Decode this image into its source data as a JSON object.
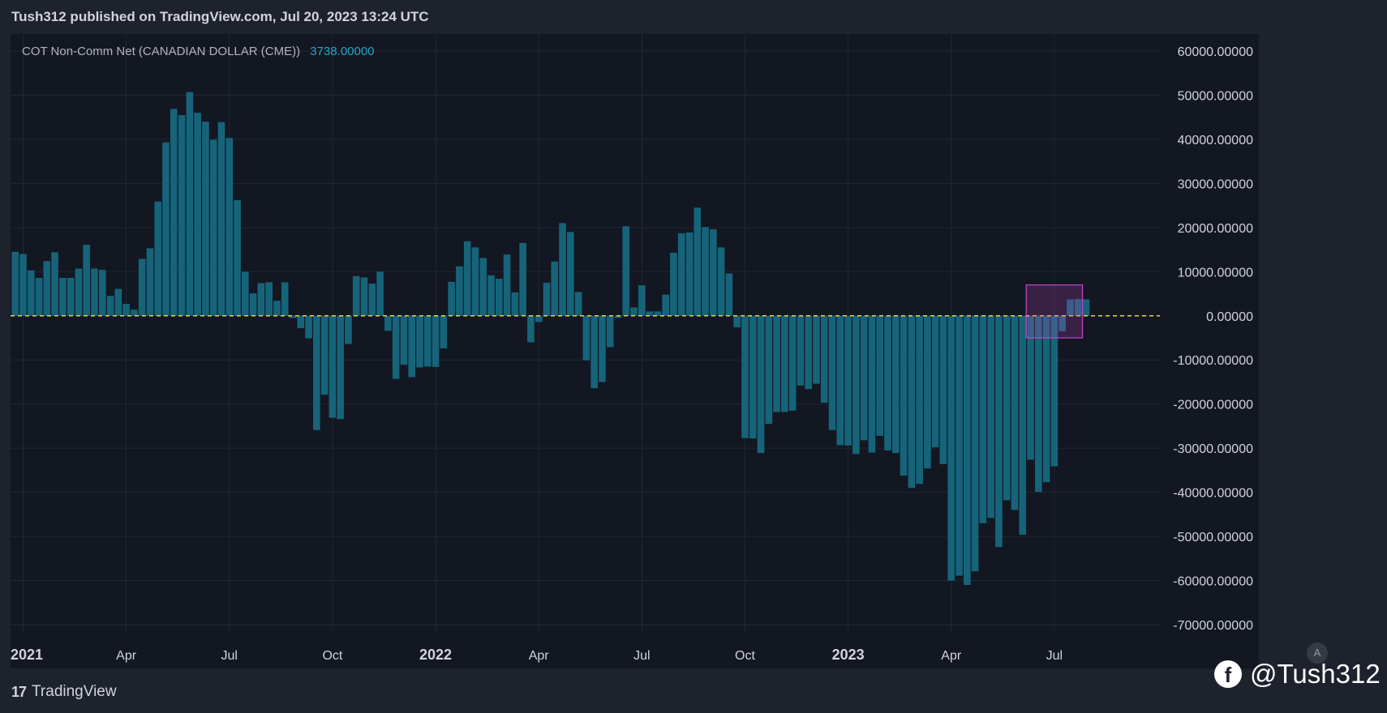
{
  "header": {
    "published": "Tush312 published on TradingView.com, Jul 20, 2023 13:24 UTC"
  },
  "legend": {
    "indicator": "COT Non-Comm Net (CANADIAN DOLLAR (CME))",
    "last_value": "3738.00000"
  },
  "footer": {
    "logo_mark": "17",
    "brand": "TradingView",
    "auto_label": "A"
  },
  "watermark": {
    "icon": "facebook-icon",
    "handle": "@Tush312"
  },
  "colors": {
    "background": "#131722",
    "bar": "#16647a",
    "zero_line": "#e6d34b",
    "highlight": "#c548c8",
    "last_value": "#22a7c6"
  },
  "chart_data": {
    "type": "bar",
    "title": "COT Non-Comm Net (CANADIAN DOLLAR (CME))",
    "last_value": 3738,
    "ylim": [
      -70000,
      60000
    ],
    "y_ticks": [
      60000,
      50000,
      40000,
      30000,
      20000,
      10000,
      0,
      -10000,
      -20000,
      -30000,
      -40000,
      -50000,
      -60000,
      -70000
    ],
    "y_tick_labels": [
      "60000.00000",
      "50000.00000",
      "40000.00000",
      "30000.00000",
      "20000.00000",
      "10000.00000",
      "0.00000",
      "-10000.00000",
      "-20000.00000",
      "-30000.00000",
      "-40000.00000",
      "-50000.00000",
      "-60000.00000",
      "-70000.00000"
    ],
    "x_tick_labels": [
      {
        "label": "2021",
        "week": 1,
        "bold": true
      },
      {
        "label": "Apr",
        "week": 14,
        "bold": false
      },
      {
        "label": "Jul",
        "week": 27,
        "bold": false
      },
      {
        "label": "Oct",
        "week": 40,
        "bold": false
      },
      {
        "label": "2022",
        "week": 53,
        "bold": true
      },
      {
        "label": "Apr",
        "week": 66,
        "bold": false
      },
      {
        "label": "Jul",
        "week": 79,
        "bold": false
      },
      {
        "label": "Oct",
        "week": 92,
        "bold": false
      },
      {
        "label": "2023",
        "week": 105,
        "bold": true
      },
      {
        "label": "Apr",
        "week": 118,
        "bold": false
      },
      {
        "label": "Jul",
        "week": 131,
        "bold": false
      }
    ],
    "grid": true,
    "zero_line": "dashed",
    "highlight_weeks": [
      128,
      134
    ],
    "highlight_y": [
      -5000,
      7000
    ],
    "values": [
      14500,
      14000,
      10300,
      8600,
      12400,
      14400,
      8600,
      8600,
      10700,
      16100,
      10700,
      10400,
      4500,
      6100,
      2700,
      1400,
      12900,
      15300,
      25900,
      39300,
      46900,
      45500,
      50700,
      46000,
      44000,
      39900,
      43900,
      40300,
      26200,
      10000,
      5100,
      7400,
      7600,
      3400,
      7600,
      -500,
      -2800,
      -5100,
      -25900,
      -17900,
      -23100,
      -23400,
      -6400,
      9000,
      8700,
      7300,
      10000,
      -3400,
      -14300,
      -11100,
      -13900,
      -11700,
      -11500,
      -11600,
      -7400,
      7700,
      11200,
      16900,
      15500,
      13100,
      9200,
      8400,
      13900,
      5300,
      16500,
      -6000,
      -1400,
      7500,
      12300,
      21000,
      19000,
      5400,
      -10100,
      -16400,
      -15000,
      -7100,
      -500,
      20300,
      1900,
      6900,
      1000,
      1000,
      4800,
      14300,
      18700,
      18900,
      24500,
      20100,
      19600,
      15500,
      9600,
      -2600,
      -27700,
      -27800,
      -31100,
      -24500,
      -21800,
      -21800,
      -21500,
      -15800,
      -16600,
      -15400,
      -19700,
      -25900,
      -29300,
      -29400,
      -31300,
      -28200,
      -31000,
      -27200,
      -30500,
      -31100,
      -36200,
      -39000,
      -38100,
      -34600,
      -29800,
      -33600,
      -60000,
      -58900,
      -61000,
      -57900,
      -47000,
      -45800,
      -52400,
      -41800,
      -44000,
      -49600,
      -32600,
      -39900,
      -37700,
      -34100,
      -3500,
      3700,
      3800,
      3738
    ]
  }
}
